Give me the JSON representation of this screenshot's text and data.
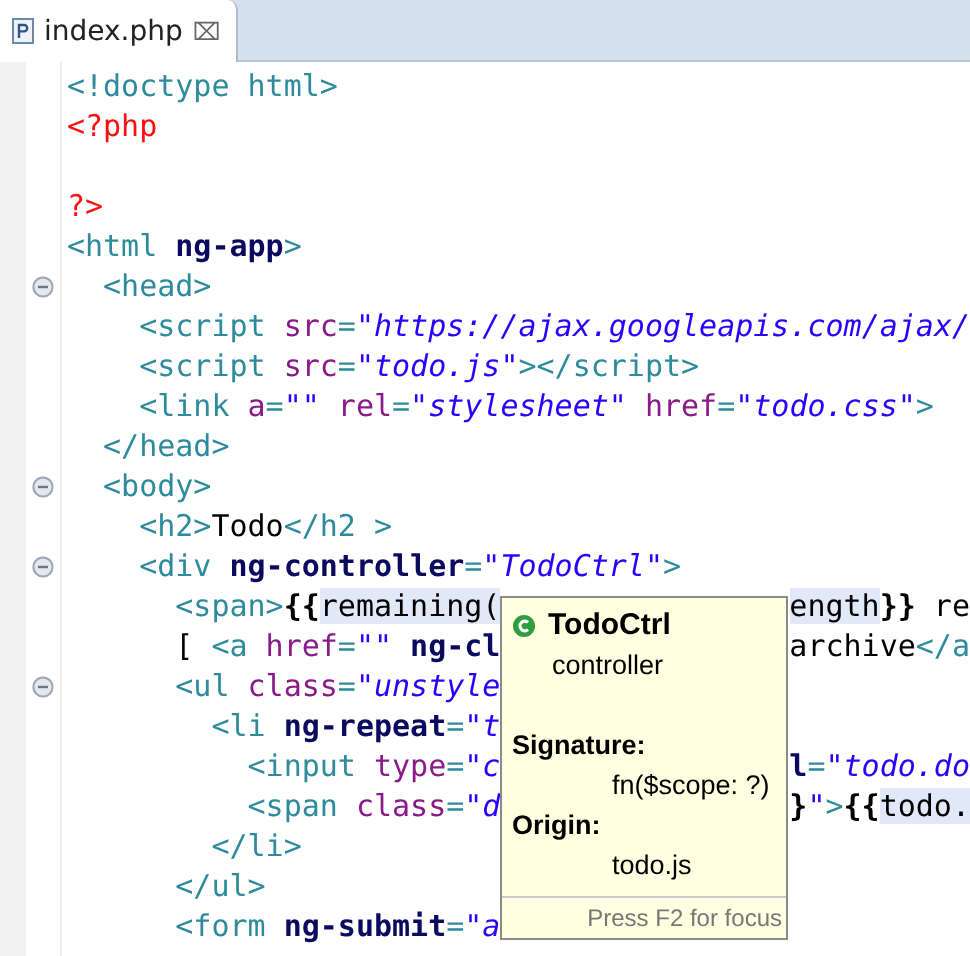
{
  "tabs": [
    {
      "label": "index.php",
      "selected": true,
      "close": "⌧"
    }
  ],
  "lines": [
    {
      "fold": false,
      "left": [
        {
          "kind": "tag",
          "t": "<!doctype html>"
        }
      ]
    },
    {
      "fold": false,
      "left": [
        {
          "kind": "php",
          "t": "<?php"
        }
      ]
    },
    {
      "fold": false
    },
    {
      "fold": false,
      "left": [
        {
          "kind": "php",
          "t": "?>"
        }
      ]
    },
    {
      "fold": false,
      "left": [
        {
          "kind": "tag",
          "t": "<html "
        },
        {
          "kind": "ng",
          "t": "ng-app"
        },
        {
          "kind": "tag",
          "t": ">"
        }
      ]
    },
    {
      "fold": true,
      "left": [
        {
          "kind": "tag",
          "t": "  <head>"
        }
      ]
    },
    {
      "fold": false,
      "left": [
        {
          "kind": "tag",
          "t": "    <script "
        },
        {
          "kind": "attr",
          "t": "src"
        },
        {
          "kind": "tag",
          "t": "="
        },
        {
          "kind": "str",
          "t": "\"https://ajax.googleapis.com/ajax/"
        }
      ]
    },
    {
      "fold": false,
      "left": [
        {
          "kind": "tag",
          "t": "    <script "
        },
        {
          "kind": "attr",
          "t": "src"
        },
        {
          "kind": "tag",
          "t": "="
        },
        {
          "kind": "str",
          "t": "\"todo.js\""
        },
        {
          "kind": "tag",
          "t": "></script>"
        }
      ]
    },
    {
      "fold": false,
      "left": [
        {
          "kind": "tag",
          "t": "    <link "
        },
        {
          "kind": "attr",
          "t": "a"
        },
        {
          "kind": "tag",
          "t": "="
        },
        {
          "kind": "str",
          "t": "\"\" "
        },
        {
          "kind": "attr",
          "t": "rel"
        },
        {
          "kind": "tag",
          "t": "="
        },
        {
          "kind": "str",
          "t": "\"stylesheet\" "
        },
        {
          "kind": "attr",
          "t": "href"
        },
        {
          "kind": "tag",
          "t": "="
        },
        {
          "kind": "str",
          "t": "\"todo.css\""
        },
        {
          "kind": "tag",
          "t": ">"
        }
      ]
    },
    {
      "fold": false,
      "left": [
        {
          "kind": "tag",
          "t": "  </head>"
        }
      ]
    },
    {
      "fold": true,
      "left": [
        {
          "kind": "tag",
          "t": "  <body>"
        }
      ]
    },
    {
      "fold": false,
      "left": [
        {
          "kind": "tag",
          "t": "    <h2>"
        },
        {
          "kind": "text",
          "t": "Todo"
        },
        {
          "kind": "tag",
          "t": "</h2 >"
        }
      ]
    },
    {
      "fold": true,
      "left": [
        {
          "kind": "tag",
          "t": "    <div "
        },
        {
          "kind": "ng",
          "t": "ng-controller"
        },
        {
          "kind": "tag",
          "t": "="
        },
        {
          "kind": "str",
          "t": "\"TodoCtrl\""
        },
        {
          "kind": "tag",
          "t": ">"
        }
      ]
    },
    {
      "fold": false,
      "left": [
        {
          "kind": "tag",
          "t": "      <span>"
        },
        {
          "kind": "brace",
          "t": "{{"
        },
        {
          "kind": "hl",
          "t": "remaining("
        }
      ],
      "right": [
        {
          "kind": "hl",
          "t": "ength"
        },
        {
          "kind": "brace",
          "t": "}}"
        },
        {
          "kind": "text",
          "t": " re"
        }
      ]
    },
    {
      "fold": false,
      "left": [
        {
          "kind": "text",
          "t": "      [ "
        },
        {
          "kind": "tag",
          "t": "<a "
        },
        {
          "kind": "attr",
          "t": "href"
        },
        {
          "kind": "tag",
          "t": "="
        },
        {
          "kind": "str",
          "t": "\"\" "
        },
        {
          "kind": "ng",
          "t": "ng-cl"
        }
      ],
      "right": [
        {
          "kind": "text",
          "t": "archive"
        },
        {
          "kind": "tag",
          "t": "</a"
        }
      ]
    },
    {
      "fold": true,
      "left": [
        {
          "kind": "tag",
          "t": "      <ul "
        },
        {
          "kind": "attr",
          "t": "class"
        },
        {
          "kind": "tag",
          "t": "="
        },
        {
          "kind": "str",
          "t": "\"unstyle"
        }
      ]
    },
    {
      "fold": false,
      "left": [
        {
          "kind": "tag",
          "t": "        <li "
        },
        {
          "kind": "ng",
          "t": "ng-repeat"
        },
        {
          "kind": "tag",
          "t": "="
        },
        {
          "kind": "str",
          "t": "\"t"
        }
      ]
    },
    {
      "fold": false,
      "left": [
        {
          "kind": "tag",
          "t": "          <input "
        },
        {
          "kind": "attr",
          "t": "type"
        },
        {
          "kind": "tag",
          "t": "="
        },
        {
          "kind": "str",
          "t": "\"c"
        }
      ],
      "right": [
        {
          "kind": "ng",
          "t": "l"
        },
        {
          "kind": "tag",
          "t": "="
        },
        {
          "kind": "str",
          "t": "\"todo.do"
        }
      ]
    },
    {
      "fold": false,
      "left": [
        {
          "kind": "tag",
          "t": "          <span "
        },
        {
          "kind": "attr",
          "t": "class"
        },
        {
          "kind": "tag",
          "t": "="
        },
        {
          "kind": "str",
          "t": "\"d"
        }
      ],
      "right": [
        {
          "kind": "brace",
          "t": "}"
        },
        {
          "kind": "str",
          "t": "\""
        },
        {
          "kind": "tag",
          "t": ">"
        },
        {
          "kind": "brace",
          "t": "{{"
        },
        {
          "kind": "hl",
          "t": "todo."
        }
      ]
    },
    {
      "fold": false,
      "left": [
        {
          "kind": "tag",
          "t": "        </li>"
        }
      ]
    },
    {
      "fold": false,
      "left": [
        {
          "kind": "tag",
          "t": "      </ul>"
        }
      ]
    },
    {
      "fold": false,
      "left": [
        {
          "kind": "tag",
          "t": "      <form "
        },
        {
          "kind": "ng",
          "t": "ng-submit"
        },
        {
          "kind": "tag",
          "t": "="
        },
        {
          "kind": "str",
          "t": "\"a"
        }
      ]
    }
  ],
  "tooltip": {
    "name": "TodoCtrl",
    "kind": "controller",
    "signature_label": "Signature:",
    "signature": "fn($scope: ?)",
    "origin_label": "Origin:",
    "origin": "todo.js",
    "footer": "Press F2 for focus"
  }
}
